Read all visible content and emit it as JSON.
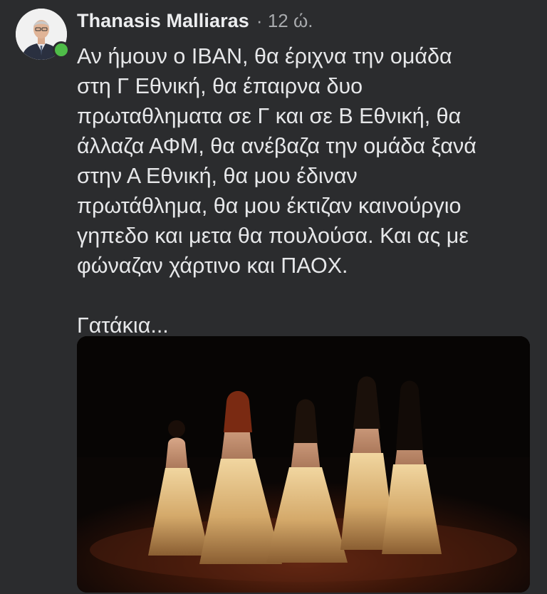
{
  "post": {
    "author": "Thanasis Malliaras",
    "separator": "·",
    "time": "12 ώ.",
    "paragraphs": [
      "Αν ήμουν ο IBAN, θα έριχνα την ομάδα\nστη Γ Εθνική, θα έπαιρνα δυο\nπρωταθληματα σε Γ και σε Β Εθνική, θα\nάλλαζα ΑΦΜ, θα ανέβαζα την ομάδα ξανά\nστην Α Εθνική, θα μου έδιναν\nπρωτάθλημα, θα μου έκτιζαν καινούργιο\nγηπεδο και μετα θα πουλούσα. Και ας με\nφώναζαν χάρτινο και ΠΑΟΧ.",
      "Γατάκια..."
    ]
  },
  "status": {
    "online": true,
    "online_color": "#4fbd49"
  },
  "theme": {
    "background": "#2b2c2e",
    "text": "#e6e7e9",
    "meta_text": "#a8aaad"
  },
  "media": {
    "type": "image",
    "subject": "five dancers in gold dresses on a dark stage"
  }
}
